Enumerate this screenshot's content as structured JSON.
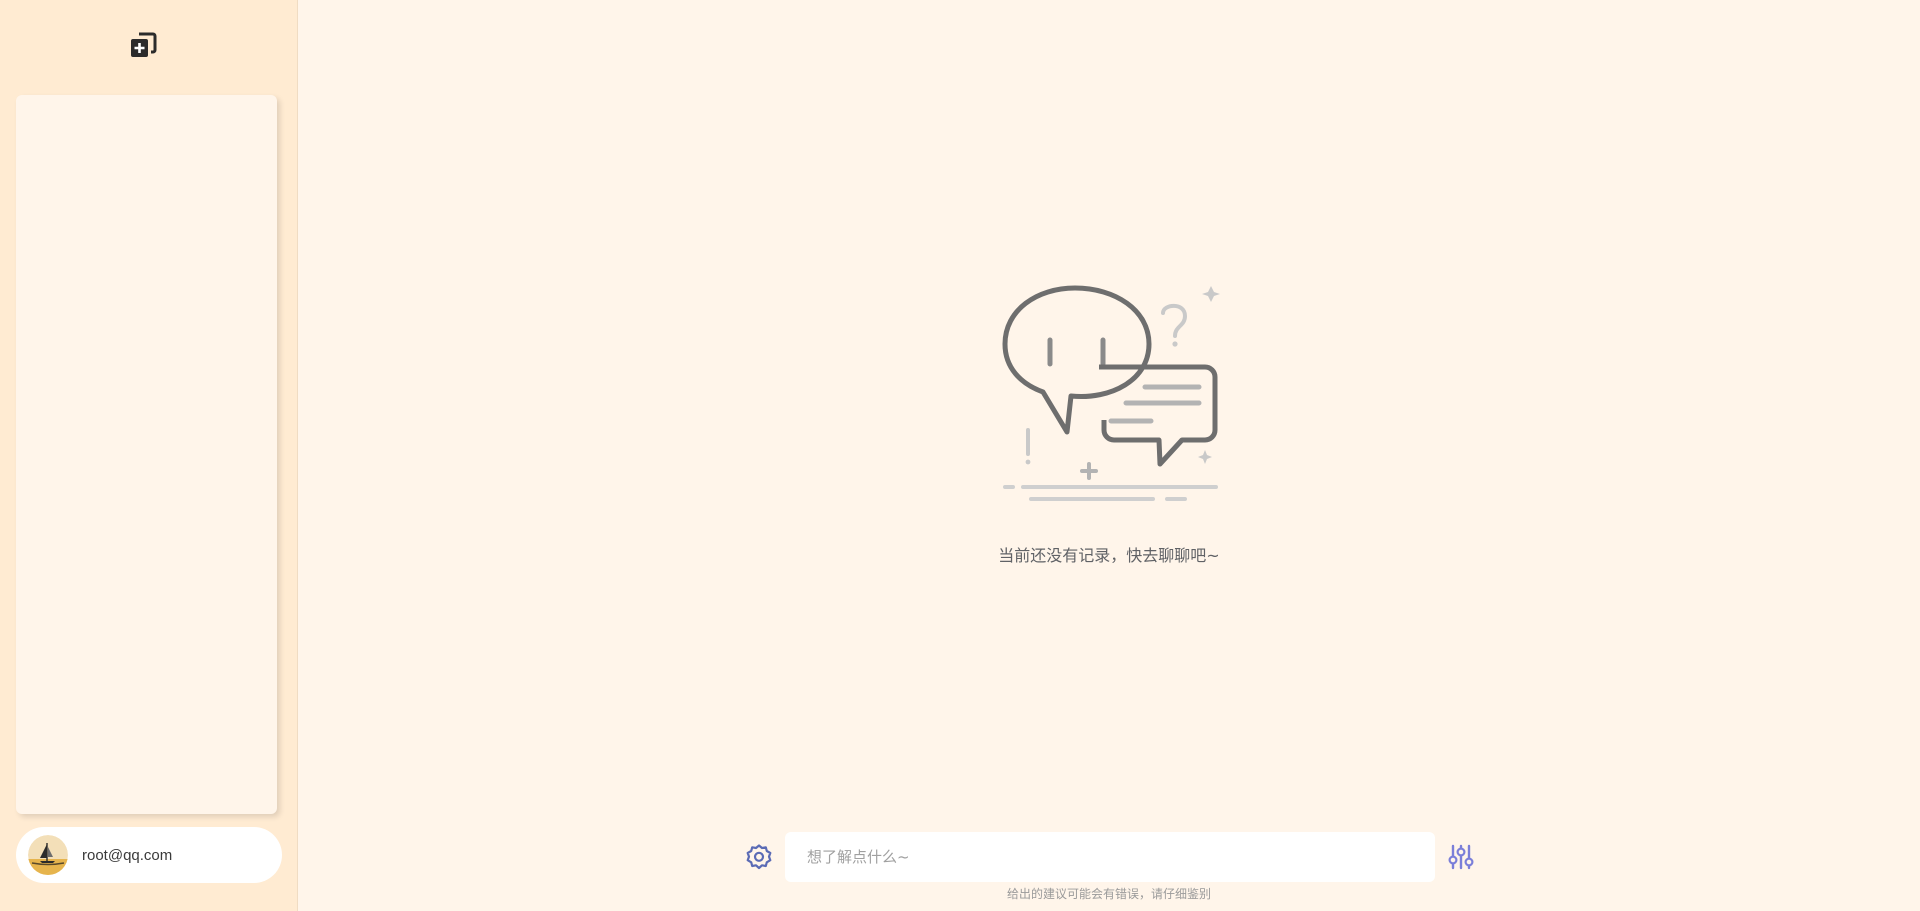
{
  "sidebar": {
    "new_chat_icon": "add-chat-icon",
    "user": {
      "email": "root@qq.com",
      "avatar_icon": "sailboat-avatar"
    }
  },
  "main": {
    "empty_state_text": "当前还没有记录，快去聊聊吧~",
    "composer": {
      "placeholder": "想了解点什么~",
      "settings_icon": "gear-icon",
      "tune_icon": "sliders-icon"
    },
    "disclaimer": "给出的建议可能会有错误，请仔细鉴别"
  },
  "colors": {
    "sidebar_bg": "#ffebd2",
    "main_bg": "#fff5ea",
    "accent": "#7b7fd9",
    "gear": "#5b6bb5"
  }
}
